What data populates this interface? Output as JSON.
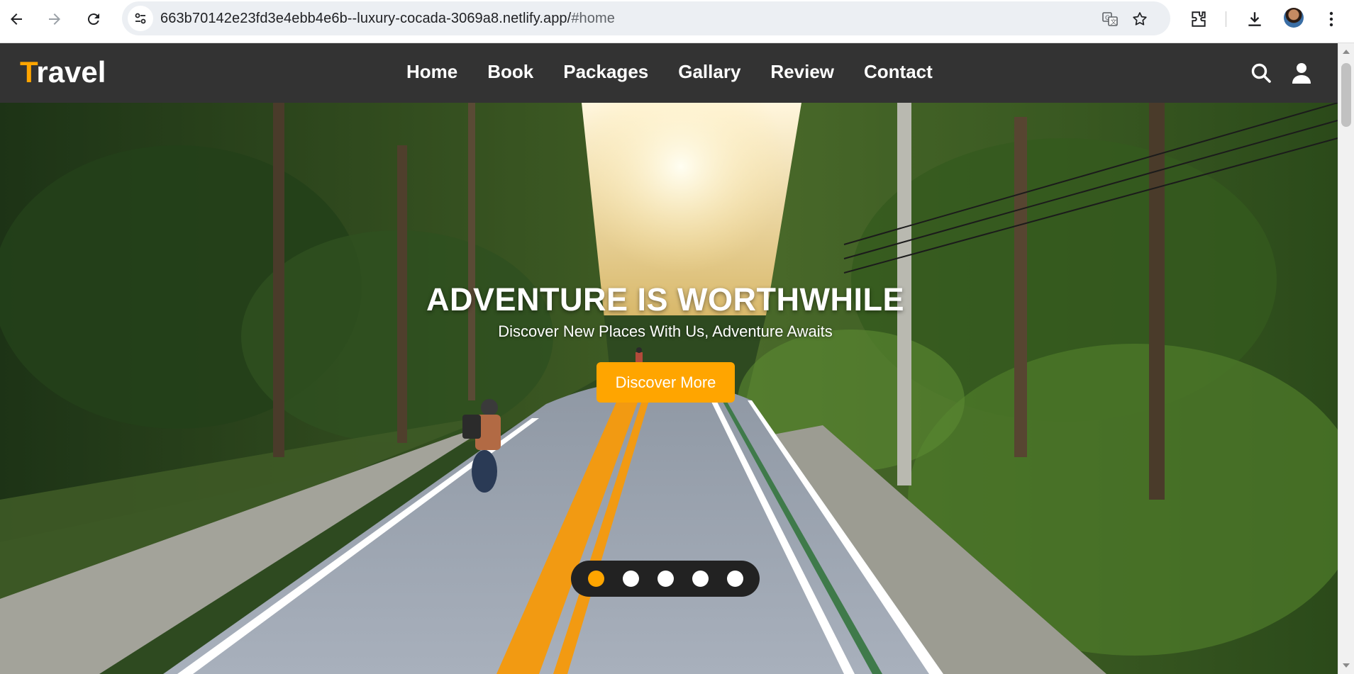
{
  "browser": {
    "url_main": "663b70142e23fd3e4ebb4e6b--luxury-cocada-3069a8.netlify.app/",
    "url_hash": "#home",
    "icons": [
      "back-icon",
      "forward-icon",
      "reload-icon",
      "site-info-icon",
      "translate-icon",
      "star-icon",
      "extensions-icon",
      "download-icon",
      "profile-avatar",
      "menu-kebab-icon"
    ]
  },
  "header": {
    "logo_first": "T",
    "logo_rest": "ravel",
    "nav": [
      "Home",
      "Book",
      "Packages",
      "Gallary",
      "Review",
      "Contact"
    ],
    "icons": [
      "search-icon",
      "user-icon"
    ]
  },
  "hero": {
    "title": "ADVENTURE IS WORTHWHILE",
    "subtitle": "Discover New Places With Us, Adventure Awaits",
    "button_label": "Discover More",
    "slide_count": 5,
    "active_slide": 1
  },
  "colors": {
    "accent": "#ffa500",
    "header_bg": "#333333",
    "dots_bg": "#222222"
  }
}
